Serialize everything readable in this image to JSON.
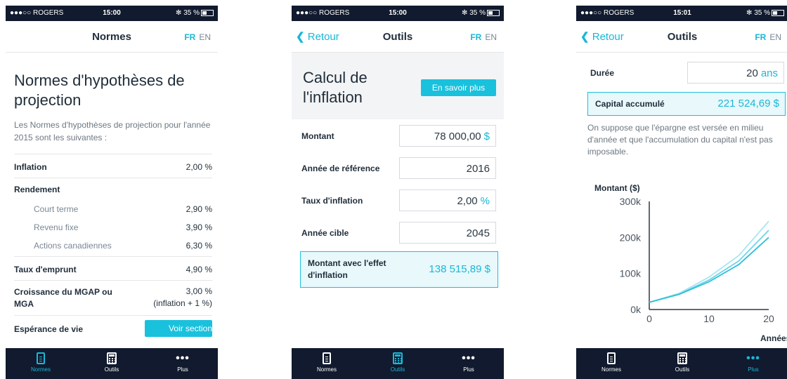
{
  "status": {
    "carrier": "●●●○○ ROGERS",
    "battery": "✻ 35 %"
  },
  "lang": {
    "fr": "FR",
    "en": "EN"
  },
  "tabs": {
    "normes": "Normes",
    "outils": "Outils",
    "plus": "Plus"
  },
  "colors": {
    "accent": "#19b8d6",
    "tabbar": "#111a2e"
  },
  "screen1": {
    "time": "15:00",
    "nav_title": "Normes",
    "title": "Normes d'hypothèses de projection",
    "description": "Les Normes d'hypothèses de projection pour l'année 2015 sont les suivantes :",
    "rows": [
      {
        "label": "Inflation",
        "value": "2,00 %"
      },
      {
        "label": "Rendement",
        "value": ""
      },
      {
        "label": "Court terme",
        "value": "2,90 %"
      },
      {
        "label": "Revenu fixe",
        "value": "3,90 %"
      },
      {
        "label": "Actions canadiennes",
        "value": "6,30 %"
      },
      {
        "label": "Taux d'emprunt",
        "value": "4,90 %"
      },
      {
        "label": "Croissance du MGAP ou MGA",
        "value": "3,00 %",
        "note": "(inflation + 1 %)"
      },
      {
        "label": "Espérance de vie",
        "button": "Voir section"
      }
    ]
  },
  "screen2": {
    "time": "15:00",
    "back": "Retour",
    "nav_title": "Outils",
    "title_line1": "Calcul de",
    "title_line2": "l'inflation",
    "learn_more": "En savoir plus",
    "fields": [
      {
        "label": "Montant",
        "value": "78 000,00",
        "unit": "$"
      },
      {
        "label": "Année de référence",
        "value": "2016",
        "unit": ""
      },
      {
        "label": "Taux d'inflation",
        "value": "2,00",
        "unit": "%"
      },
      {
        "label": "Année cible",
        "value": "2045",
        "unit": ""
      }
    ],
    "result_label": "Montant avec l'effet d'inflation",
    "result_value": "138 515,89 $"
  },
  "screen3": {
    "time": "15:01",
    "back": "Retour",
    "nav_title": "Outils",
    "duration_label": "Durée",
    "duration_value": "20",
    "duration_unit": "ans",
    "capital_label": "Capital accumulé",
    "capital_value": "221 524,69 $",
    "note": "On suppose que l'épargne est versée en milieu d'année et que l'accumulation du capital n'est pas imposable."
  },
  "chart_data": {
    "type": "line",
    "ylabel": "Montant ($)",
    "xlabel": "Années",
    "ylim": [
      0,
      300000
    ],
    "xlim": [
      0,
      20
    ],
    "y_ticks": [
      "0k",
      "100k",
      "200k",
      "300k"
    ],
    "x_ticks": [
      "0",
      "10",
      "20"
    ],
    "series": [
      {
        "x": [
          0,
          5,
          10,
          15,
          20
        ],
        "values": [
          20000,
          45000,
          90000,
          150000,
          245000
        ]
      },
      {
        "x": [
          0,
          5,
          10,
          15,
          20
        ],
        "values": [
          20000,
          43000,
          82000,
          135000,
          220000
        ]
      },
      {
        "x": [
          0,
          5,
          10,
          15,
          20
        ],
        "values": [
          20000,
          42000,
          77000,
          125000,
          200000
        ]
      }
    ]
  }
}
